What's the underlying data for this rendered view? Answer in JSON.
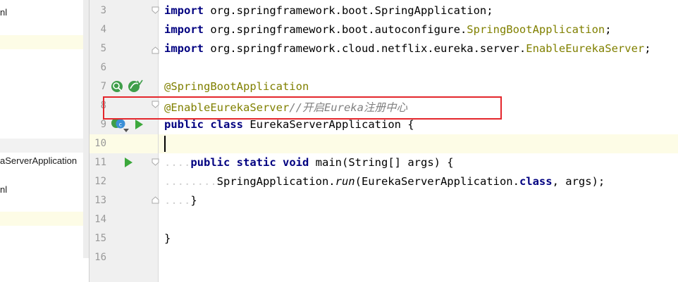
{
  "project_panel": {
    "items": [
      {
        "label": "nl"
      },
      {
        "label": "aServerApplication"
      },
      {
        "label": "nl"
      }
    ]
  },
  "gutter": {
    "line_numbers": [
      "3",
      "4",
      "5",
      "6",
      "7",
      "8",
      "9",
      "10",
      "11",
      "12",
      "13",
      "14",
      "15",
      "16"
    ]
  },
  "editor": {
    "lines": {
      "l3": {
        "kw": "import",
        "pkg": " org.springframework.boot.SpringApplication;"
      },
      "l4": {
        "kw": "import",
        "pkg": " org.springframework.boot.autoconfigure.",
        "cls": "SpringBootApplication",
        "end": ";"
      },
      "l5": {
        "kw": "import",
        "pkg": " org.springframework.cloud.netflix.eureka.server.",
        "cls": "EnableEurekaServer",
        "end": ";"
      },
      "l7": {
        "ann": "@SpringBootApplication"
      },
      "l8": {
        "ann": "@EnableEurekaServer",
        "comment": "//开启Eureka注册中心"
      },
      "l9": {
        "kw1": "public",
        "kw2": "class",
        "rest": " EurekaServerApplication {"
      },
      "l11": {
        "dots": "....",
        "kw1": "public",
        "kw2": "static",
        "kw3": "void",
        "rest": " main(String[] args) {"
      },
      "l12": {
        "dots": "........",
        "pre": "SpringApplication.",
        "fn": "run",
        "mid": "(EurekaServerApplication.",
        "kw": "class",
        "end": ", args);"
      },
      "l13": {
        "dots": "....",
        "rest": "}"
      },
      "l15": {
        "rest": "}"
      }
    }
  },
  "colors": {
    "keyword": "#000080",
    "annotation": "#808000",
    "comment": "#808080",
    "highlight_box": "#e4262c",
    "current_line": "#fdfce6"
  }
}
